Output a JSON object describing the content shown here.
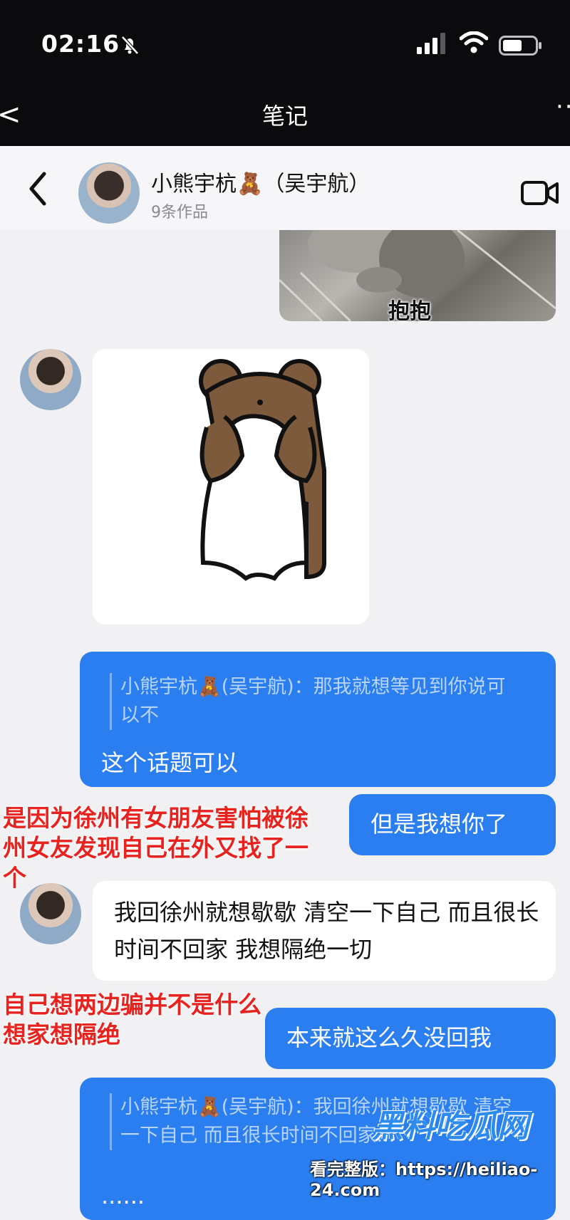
{
  "status_bar": {
    "time": "02:16"
  },
  "outer_nav": {
    "back": "<",
    "title": "笔记",
    "more": "··"
  },
  "chat_header": {
    "contact_name": "小熊宇杭🧸（吴宇航）",
    "contact_sub": "9条作品"
  },
  "messages": {
    "cat_caption": "抱抱",
    "quote_1": "小熊宇杭🧸(吴宇航)：那我就想等见到你说可以不",
    "reply_1": "这个话题可以",
    "out_2": "但是我想你了",
    "in_2": "我回徐州就想歇歇 清空一下自己 而且很长时间不回家 我想隔绝一切",
    "out_3": "本来就这么久没回我",
    "quote_2": "小熊宇杭🧸(吴宇航)：我回徐州就想歇歇 清空一下自己 而且很长时间不回家...",
    "reply_2": "......"
  },
  "annotations": {
    "note_1": "是因为徐州有女朋友害怕被徐州女友发现自己在外又找了一个",
    "note_2": "自己想两边骗并不是什么想家想隔绝"
  },
  "watermark": {
    "logo": "黑料吃瓜网",
    "url_line": "看完整版：https://heiliao-24.com"
  },
  "colors": {
    "outgoing_bubble": "#2b7ef0",
    "incoming_bubble": "#ffffff",
    "annotation": "#e8231f"
  }
}
